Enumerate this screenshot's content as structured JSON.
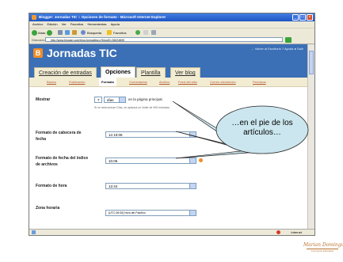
{
  "browser": {
    "title": "Blogger: Jornadas TIC :: Opciones de formato - Microsoft Internet Explorer",
    "menu": [
      "Archivo",
      "Edición",
      "Ver",
      "Favoritos",
      "Herramientas",
      "Ayuda"
    ],
    "toolbar": {
      "back": "Atrás",
      "search": "Búsqueda",
      "favorites": "Favoritos"
    },
    "address_label": "Dirección",
    "address": "http://www.blogger.com/blog-formatting.g?blogID=36024899",
    "status_zone": "Internet"
  },
  "blog": {
    "title": "Jornadas TIC",
    "top_links": "← Volver al Escritorio   ? Ayuda   ● Salir",
    "tabs": [
      "Creación de entradas",
      "Opciones",
      "Plantilla",
      "Ver blog"
    ],
    "active_tab": "Opciones",
    "subtabs": [
      "Básico",
      "Publicación",
      "Formato",
      "Comentarios",
      "Archivo",
      "Feed del sitio",
      "Correo electrónico",
      "Permisos"
    ],
    "active_subtab": "Formato"
  },
  "form": {
    "mostrar": {
      "label": "Mostrar",
      "value": "7",
      "unit": "días",
      "suffix": "en la página principal.",
      "hint": "Si se seleccionan Días, se aplicará un límite de 999 entradas."
    },
    "cabecera": {
      "label": "Formato de cabecera de fecha",
      "value": "14 10:06"
    },
    "indice": {
      "label": "Formato de fecha del índice de archivos",
      "value": "10.06"
    },
    "hora": {
      "label": "Formato de hora",
      "value": "12:44"
    },
    "zona": {
      "label": "Zona horaria",
      "value": "[UTC-06:00] Hora del Pacífico"
    }
  },
  "callout": {
    "text": "…en el pie de los artículos…"
  },
  "watermark": {
    "signature": "Marian Dominguez",
    "subtitle": "Formación Educativa"
  }
}
